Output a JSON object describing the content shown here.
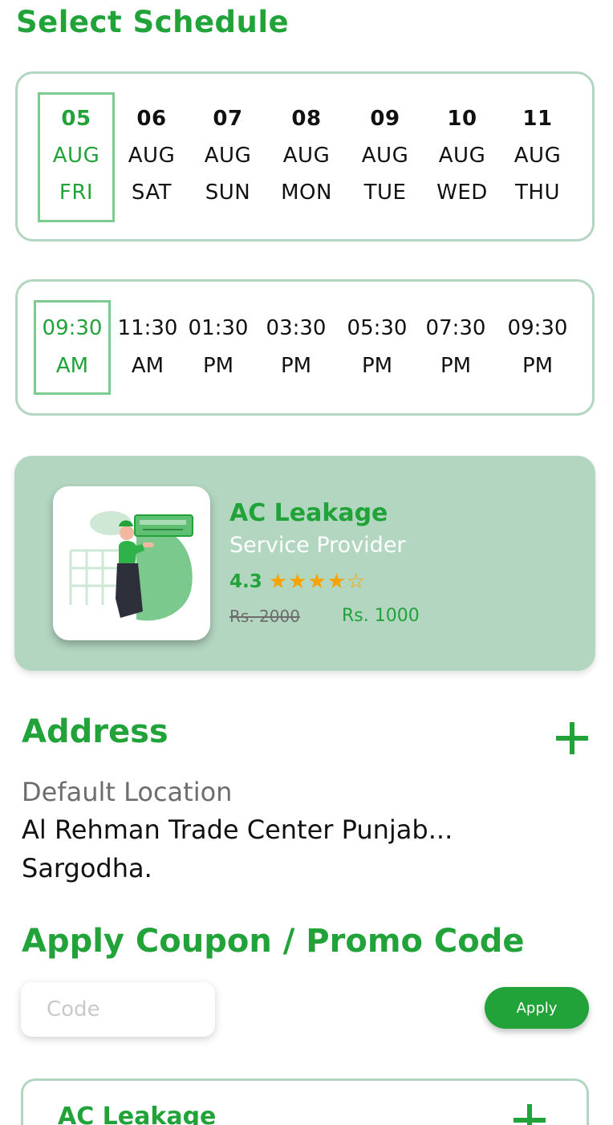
{
  "page": {
    "title": "Select Schedule"
  },
  "dates": [
    {
      "day": "05",
      "month": "AUG",
      "weekday": "FRI",
      "selected": true
    },
    {
      "day": "06",
      "month": "AUG",
      "weekday": "SAT",
      "selected": false
    },
    {
      "day": "07",
      "month": "AUG",
      "weekday": "SUN",
      "selected": false
    },
    {
      "day": "08",
      "month": "AUG",
      "weekday": "MON",
      "selected": false
    },
    {
      "day": "09",
      "month": "AUG",
      "weekday": "TUE",
      "selected": false
    },
    {
      "day": "10",
      "month": "AUG",
      "weekday": "WED",
      "selected": false
    },
    {
      "day": "11",
      "month": "AUG",
      "weekday": "THU",
      "selected": false
    }
  ],
  "times": [
    {
      "time": "09:30",
      "period": "AM",
      "selected": true
    },
    {
      "time": "11:30",
      "period": "AM",
      "selected": false
    },
    {
      "time": "01:30",
      "period": "PM",
      "selected": false
    },
    {
      "time": "03:30",
      "period": "PM",
      "selected": false
    },
    {
      "time": "05:30",
      "period": "PM",
      "selected": false
    },
    {
      "time": "07:30",
      "period": "PM",
      "selected": false
    },
    {
      "time": "09:30",
      "period": "PM",
      "selected": false
    }
  ],
  "service": {
    "name": "AC Leakage",
    "subtitle": "Service Provider",
    "rating": "4.3",
    "rating_stars": 4,
    "rating_max": 5,
    "old_price": "Rs. 2000",
    "new_price": "Rs. 1000"
  },
  "address": {
    "title": "Address",
    "label": "Default Location",
    "line1": "Al Rehman Trade Center Punjab...",
    "line2": "Sargodha."
  },
  "coupon": {
    "title": "Apply Coupon / Promo Code",
    "placeholder": "Code",
    "apply_label": "Apply"
  },
  "summary": {
    "item_name": "AC Leakage"
  },
  "colors": {
    "accent": "#21a33a",
    "card_border": "#b3d6c0",
    "card_fill": "#b3d6c0",
    "star": "#f6a300",
    "muted": "#6d6d6d"
  }
}
